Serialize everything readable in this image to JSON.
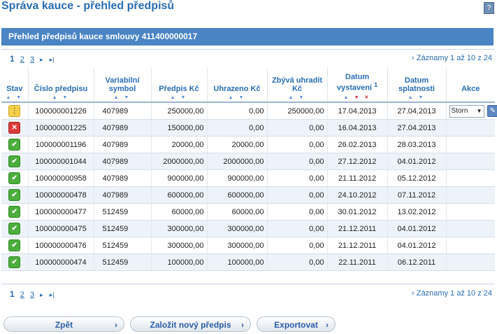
{
  "page": {
    "title": "Správa kauce - přehled předpisů",
    "help": "?"
  },
  "panel": {
    "header": "Přehled předpisů kauce smlouvy 411400000017"
  },
  "pager": {
    "pages": [
      "1",
      "2",
      "3"
    ],
    "next": "▸",
    "last": "▸|",
    "records": "Záznamy 1 až 10 z 24"
  },
  "table": {
    "columns": {
      "stav": "Stav",
      "cislo": "Číslo předpisu",
      "vs": "Variabilní symbol",
      "predpis": "Předpis Kč",
      "uhrazeno": "Uhrazeno Kč",
      "zbyva": "Zbývá uhradit Kč",
      "vystaveni": "Datum vystavení",
      "vystaveni_sup": "1",
      "splatnosti": "Datum splatnosti",
      "akce": "Akce"
    },
    "rows": [
      {
        "status": "pending",
        "cislo": "100000001226",
        "vs": "407989",
        "predpis": "250000,00",
        "uhrazeno": "0,00",
        "zbyva": "250000,00",
        "vystaveni": "17.04.2013",
        "splatnosti": "27.04.2013",
        "akce": "Storn"
      },
      {
        "status": "cancelled",
        "cislo": "100000001225",
        "vs": "407989",
        "predpis": "150000,00",
        "uhrazeno": "0,00",
        "zbyva": "0,00",
        "vystaveni": "16.04.2013",
        "splatnosti": "27.04.2013",
        "akce": ""
      },
      {
        "status": "paid",
        "cislo": "100000001196",
        "vs": "407989",
        "predpis": "20000,00",
        "uhrazeno": "20000,00",
        "zbyva": "0,00",
        "vystaveni": "26.02.2013",
        "splatnosti": "28.03.2013",
        "akce": ""
      },
      {
        "status": "paid",
        "cislo": "100000001044",
        "vs": "407989",
        "predpis": "2000000,00",
        "uhrazeno": "2000000,00",
        "zbyva": "0,00",
        "vystaveni": "27.12.2012",
        "splatnosti": "04.01.2012",
        "akce": ""
      },
      {
        "status": "paid",
        "cislo": "100000000958",
        "vs": "407989",
        "predpis": "900000,00",
        "uhrazeno": "900000,00",
        "zbyva": "0,00",
        "vystaveni": "21.11.2012",
        "splatnosti": "05.12.2012",
        "akce": ""
      },
      {
        "status": "paid",
        "cislo": "100000000478",
        "vs": "407989",
        "predpis": "600000,00",
        "uhrazeno": "600000,00",
        "zbyva": "0,00",
        "vystaveni": "24.10.2012",
        "splatnosti": "07.11.2012",
        "akce": ""
      },
      {
        "status": "paid",
        "cislo": "100000000477",
        "vs": "512459",
        "predpis": "60000,00",
        "uhrazeno": "60000,00",
        "zbyva": "0,00",
        "vystaveni": "30.01.2012",
        "splatnosti": "13.02.2012",
        "akce": ""
      },
      {
        "status": "paid",
        "cislo": "100000000475",
        "vs": "512459",
        "predpis": "300000,00",
        "uhrazeno": "300000,00",
        "zbyva": "0,00",
        "vystaveni": "21.12.2011",
        "splatnosti": "04.01.2012",
        "akce": ""
      },
      {
        "status": "paid",
        "cislo": "100000000476",
        "vs": "512459",
        "predpis": "300000,00",
        "uhrazeno": "300000,00",
        "zbyva": "0,00",
        "vystaveni": "21.12.2011",
        "splatnosti": "04.01.2012",
        "akce": ""
      },
      {
        "status": "paid",
        "cislo": "100000000474",
        "vs": "512459",
        "predpis": "100000,00",
        "uhrazeno": "100000,00",
        "zbyva": "0,00",
        "vystaveni": "22.11.2011",
        "splatnosti": "06.12.2011",
        "akce": ""
      }
    ]
  },
  "buttons": {
    "back": "Zpět",
    "new": "Založit nový předpis",
    "export": "Exportovat"
  },
  "colors": {
    "accent": "#2a6db5",
    "header_bar": "#4a84c5",
    "ok": "#4cae3c",
    "error": "#d93b3b",
    "pending": "#f5d04b"
  }
}
